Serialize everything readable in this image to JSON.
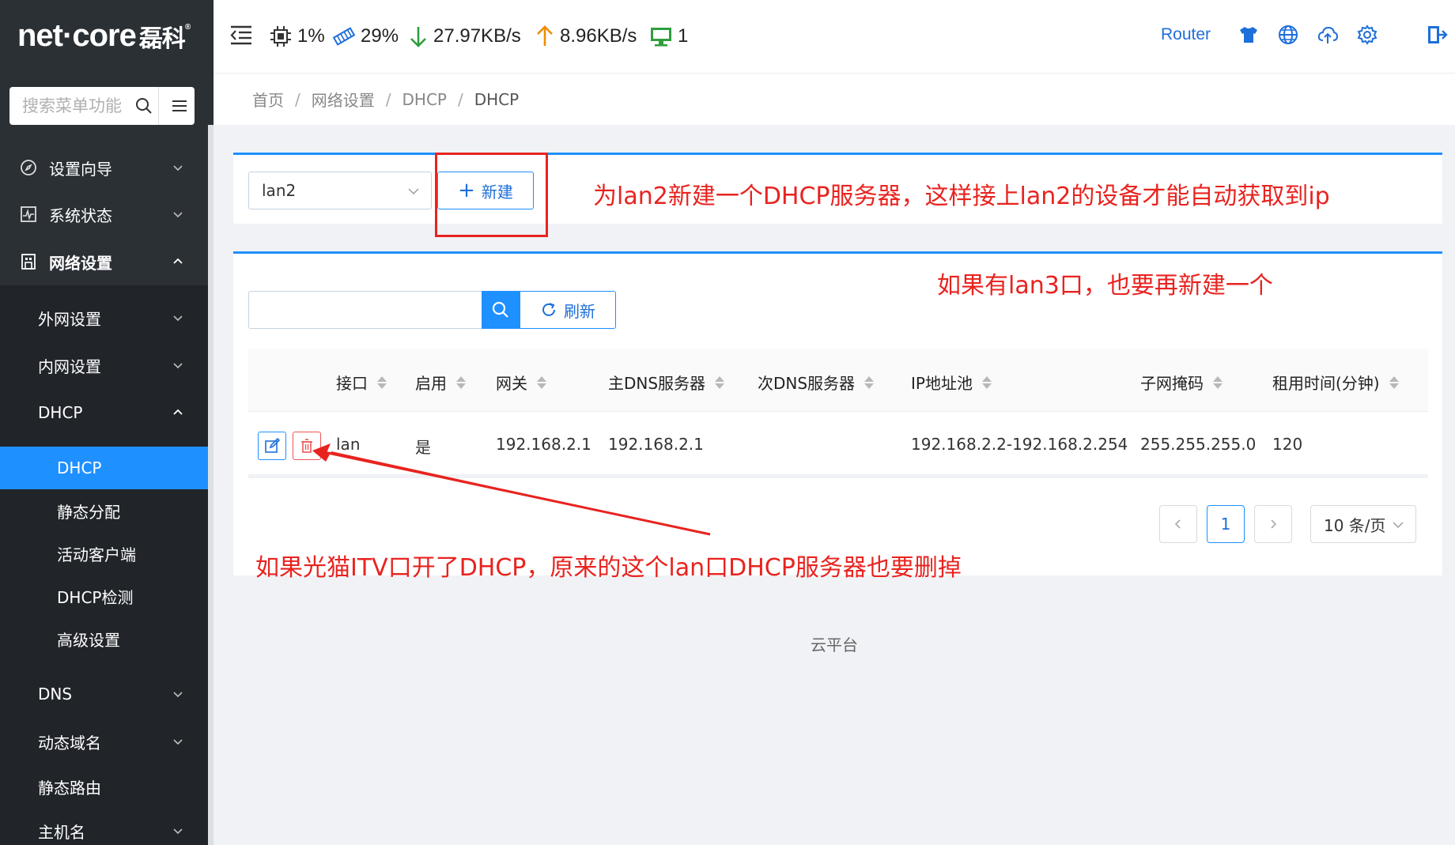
{
  "brand": {
    "name": "net·core",
    "cn": "磊科",
    "mark": "®"
  },
  "sidebar": {
    "search_placeholder": "搜索菜单功能",
    "items": [
      {
        "label": "设置向导",
        "icon": "compass-icon"
      },
      {
        "label": "系统状态",
        "icon": "chart-icon"
      },
      {
        "label": "网络设置",
        "icon": "building-icon"
      },
      {
        "label": "外网设置"
      },
      {
        "label": "内网设置"
      },
      {
        "label": "DHCP"
      },
      {
        "label": "DHCP"
      },
      {
        "label": "静态分配"
      },
      {
        "label": "活动客户端"
      },
      {
        "label": "DHCP检测"
      },
      {
        "label": "高级设置"
      },
      {
        "label": "DNS"
      },
      {
        "label": "动态域名"
      },
      {
        "label": "静态路由"
      },
      {
        "label": "主机名"
      }
    ]
  },
  "topbar": {
    "cpu": "1%",
    "memory": "29%",
    "download": "27.97KB/s",
    "upload": "8.96KB/s",
    "devices": "1",
    "router_label": "Router",
    "colors": {
      "download": "#2e9e3e",
      "upload": "#f08c00",
      "devices": "#2e9e3e",
      "accent": "#1e90ff"
    }
  },
  "breadcrumb": [
    "首页",
    "网络设置",
    "DHCP",
    "DHCP"
  ],
  "toolbar": {
    "interface_value": "lan2",
    "new_label": "新建"
  },
  "table": {
    "search_value": "",
    "refresh_label": "刷新",
    "columns": [
      "接口",
      "启用",
      "网关",
      "主DNS服务器",
      "次DNS服务器",
      "IP地址池",
      "子网掩码",
      "租用时间(分钟)"
    ],
    "rows": [
      {
        "interface": "lan",
        "enabled": "是",
        "gateway": "192.168.2.1",
        "dns1": "192.168.2.1",
        "dns2": "",
        "pool": "192.168.2.2-192.168.2.254",
        "mask": "255.255.255.0",
        "lease": "120"
      }
    ]
  },
  "pagination": {
    "current": "1",
    "page_size": "10 条/页"
  },
  "footer": "云平台",
  "annotations": {
    "a1": "为lan2新建一个DHCP服务器，这样接上lan2的设备才能自动获取到ip",
    "a2": "如果有lan3口，也要再新建一个",
    "a3": "如果光猫ITV口开了DHCP，原来的这个lan口DHCP服务器也要删掉",
    "color": "#e8231f"
  }
}
